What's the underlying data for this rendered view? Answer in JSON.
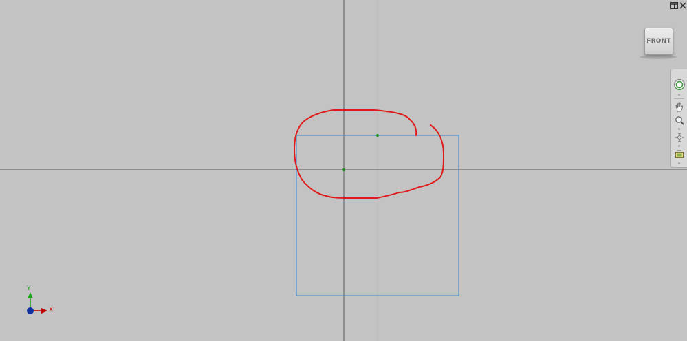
{
  "window": {
    "restore_icon": "split-window-icon",
    "close_icon": "close-x-icon"
  },
  "viewcube": {
    "face_label": "FRONT"
  },
  "nav_bar": {
    "tools": [
      {
        "name": "steering-wheel",
        "icon": "steering-wheel-icon"
      },
      {
        "name": "pan",
        "icon": "hand-pan-icon"
      },
      {
        "name": "zoom",
        "icon": "magnifier-zoom-icon"
      },
      {
        "name": "orbit",
        "icon": "orbit-icon"
      },
      {
        "name": "look-at",
        "icon": "look-at-icon"
      }
    ]
  },
  "triad": {
    "y_label": "Y",
    "x_label": "X"
  },
  "colors": {
    "background": "#c3c3c3",
    "axis_line": "#5a5a5a",
    "sketch_rectangle": "#3a86d6",
    "markup_stroke": "#e01b1b",
    "point": "#1a8f1a",
    "y_axis_color": "#1aa51a",
    "x_axis_color": "#c00000",
    "origin_dot": "#1030a0"
  }
}
